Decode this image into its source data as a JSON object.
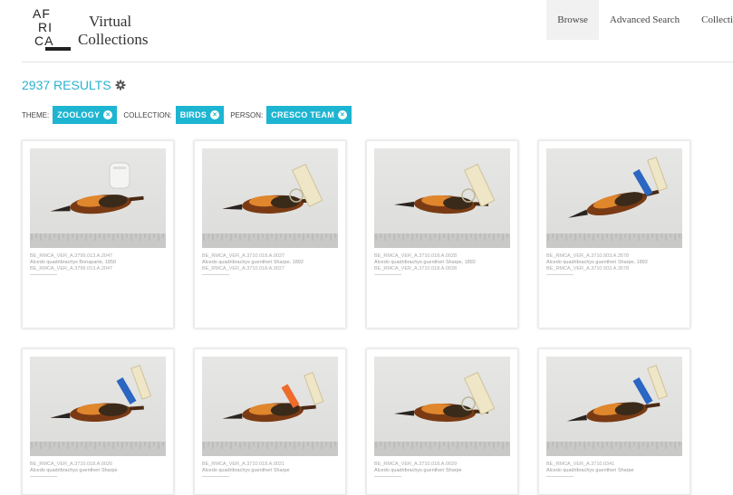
{
  "logo": {
    "letters": [
      "AF",
      "RI",
      "CA"
    ],
    "line1": "Virtual",
    "line2": "Collections"
  },
  "nav": [
    "Browse",
    "Advanced Search",
    "Collecti"
  ],
  "results": {
    "count_text": "2937 RESULTS",
    "settings_icon": "gear-icon"
  },
  "filters": [
    {
      "label": "THEME:",
      "value": "ZOOLOGY"
    },
    {
      "label": "COLLECTION:",
      "value": "BIRDS"
    },
    {
      "label": "PERSON:",
      "value": "CRESCO TEAM"
    }
  ],
  "cards": [
    {
      "id": "BE_RMCA_VER_A.3799.013.A.2047",
      "name": "Alcedo quadribrachys Bonaparte, 1850",
      "code": "BE_RMCA_VER_A.3799.013.A.2047",
      "tag": "white",
      "hr": "rgba(0,0,0,0)"
    },
    {
      "id": "BE_RMCA_VER_A.3710.018.A.0027",
      "name": "Alcedo quadribrachys guentheri Sharpe, 1892",
      "code": "BE_RMCA_VER_A.3710.018.A.0027",
      "tag": "paper",
      "hr": "rgba(0,0,0,0)"
    },
    {
      "id": "BE_RMCA_VER_A.3710.018.A.0028",
      "name": "Alcedo quadribrachys guentheri Sharpe, 1892",
      "code": "BE_RMCA_VER_A.3710.018.A.0028",
      "tag": "paper",
      "hr": "rgba(0,0,0,0)"
    },
    {
      "id": "BE_RMCA_VER_A.3710.003.A.3578",
      "name": "Alcedo quadribrachys guentheri Sharpe, 1892",
      "code": "BE_RMCA_VER_A.3710.003.A.3578",
      "tag": "blue",
      "hr": "rgba(0,0,0,0)"
    },
    {
      "id": "BE_RMCA_VER_A.3710.018.A.0026",
      "name": "Alcedo quadribrachys guentheri Sharpe",
      "code": "",
      "tag": "blue",
      "hr": ""
    },
    {
      "id": "BE_RMCA_VER_A.3710.018.A.0021",
      "name": "Alcedo quadribrachys guentheri Sharpe",
      "code": "",
      "tag": "orange",
      "hr": ""
    },
    {
      "id": "BE_RMCA_VER_A.3710.018.A.0029",
      "name": "Alcedo quadribrachys guentheri Sharpe",
      "code": "",
      "tag": "paper",
      "hr": ""
    },
    {
      "id": "BE_RMCA_VER_A.3710.0341",
      "name": "Alcedo quadribrachys guentheri Sharpe",
      "code": "",
      "tag": "blue",
      "hr": ""
    }
  ]
}
